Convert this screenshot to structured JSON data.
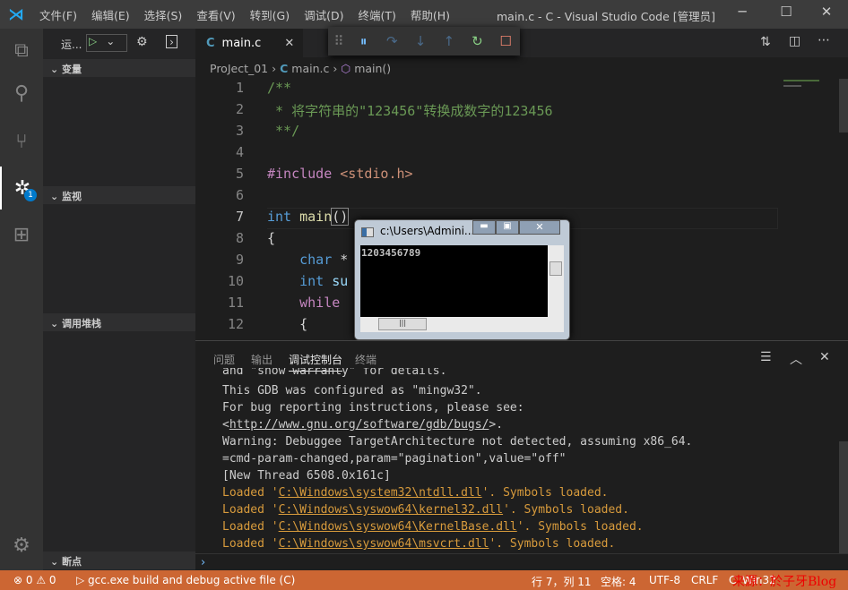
{
  "titlebar": {
    "menus": [
      "文件(F)",
      "编辑(E)",
      "选择(S)",
      "查看(V)",
      "转到(G)",
      "调试(D)",
      "终端(T)",
      "帮助(H)"
    ],
    "title": "main.c - C - Visual Studio Code [管理员]"
  },
  "activity": {
    "debug_badge": "1"
  },
  "sidebar": {
    "run_label": "运...",
    "sections": [
      "变量",
      "监视",
      "调用堆栈",
      "断点"
    ]
  },
  "editor": {
    "tab": "main.c",
    "breadcrumb": [
      "ProJect_01",
      "main.c",
      "main()"
    ],
    "lines": [
      "1",
      "2",
      "3",
      "4",
      "5",
      "6",
      "7",
      "8",
      "9",
      "10",
      "11",
      "12"
    ]
  },
  "code": {
    "l1": "/**",
    "l2": " * 将字符串的\"123456\"转换成数字的123456",
    "l3": " **/",
    "l5a": "#include ",
    "l5b": "<stdio.h>",
    "l7a": "int ",
    "l7b": "main",
    "l7c": "()",
    "l8": "{",
    "l9a": "    char ",
    "l9b": "*",
    "l10a": "    int ",
    "l10b": "su",
    "l11": "    while",
    "l12": "    {"
  },
  "console": {
    "title": "c:\\Users\\Admini...",
    "output": "1203456789"
  },
  "panel": {
    "tabs": [
      "问题",
      "输出",
      "调试控制台",
      "终端"
    ],
    "active_tab": "调试控制台",
    "lines": [
      "and \"show warranty\" for details.",
      "This GDB was configured as \"mingw32\".",
      "For bug reporting instructions, please see:",
      "=cmd-param-changed,param=\"pagination\",value=\"off\"",
      "[New Thread 6508.0x161c]",
      "Warning: Debuggee TargetArchitecture not detected, assuming x86_64."
    ],
    "url": "http://www.gnu.org/software/gdb/bugs/",
    "loaded": [
      "C:\\Windows\\system32\\ntdll.dll",
      "C:\\Windows\\syswow64\\kernel32.dll",
      "C:\\Windows\\syswow64\\KernelBase.dll",
      "C:\\Windows\\syswow64\\msvcrt.dll"
    ],
    "loaded_prefix": "Loaded '",
    "loaded_suffix": "'. Symbols loaded."
  },
  "status": {
    "errors": "0",
    "warnings": "0",
    "launch": "gcc.exe build and debug active file (C)",
    "position": "行 7，列 11",
    "spaces": "空格: 4",
    "encoding": "UTF-8",
    "eol": "CRLF",
    "lang": "C",
    "platform": "Win32",
    "watermark": "来源：於子牙Blog"
  },
  "colors": {
    "statusbar": "#cc6633",
    "accent": "#007acc"
  }
}
